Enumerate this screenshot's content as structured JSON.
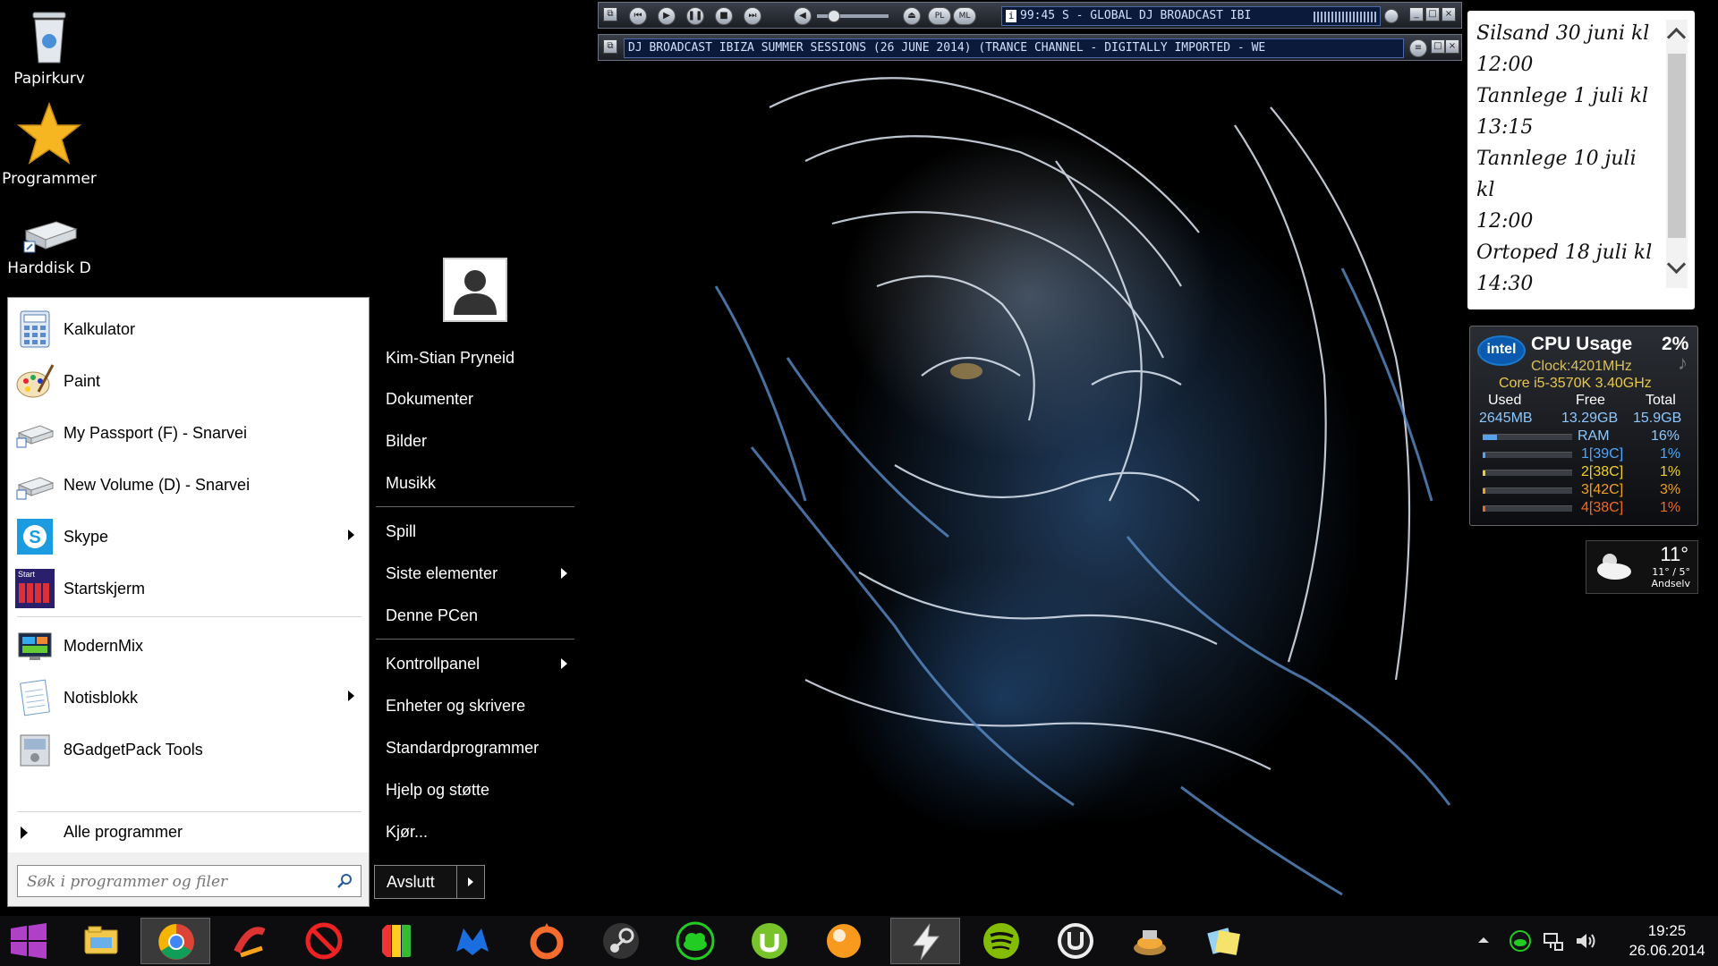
{
  "desktop": {
    "icons": [
      {
        "label": "Papirkurv",
        "icon": "recycle-bin-icon"
      },
      {
        "label": "Programmer",
        "icon": "star-icon"
      },
      {
        "label": "Harddisk D",
        "icon": "hard-drive-icon"
      }
    ]
  },
  "winamp": {
    "time": "99:45",
    "title_scroll": "S - GLOBAL DJ BROADCAST IBI",
    "playlist_scroll": "DJ BROADCAST IBIZA SUMMER SESSIONS (26 JUNE 2014) (TRANCE CHANNEL - DIGITALLY IMPORTED - WE",
    "buttons": [
      "PL",
      "ML"
    ]
  },
  "calendar_note": {
    "lines": [
      "Silsand 30 juni kl",
      "12:00",
      "Tannlege 1 juli kl",
      "13:15",
      "Tannlege 10 juli kl",
      "12:00",
      "Ortoped 18 juli kl",
      "14:30"
    ]
  },
  "cpu_gadget": {
    "brand": "intel",
    "title": "CPU Usage",
    "usage": "2%",
    "clock": "Clock:4201MHz",
    "model": "Core i5-3570K 3.40GHz",
    "headers": [
      "Used",
      "Free",
      "Total"
    ],
    "values": [
      "2645MB",
      "13.29GB",
      "15.9GB"
    ],
    "ram_label": "RAM",
    "ram_pct": "16%",
    "ram_fraction": 0.16,
    "cores": [
      {
        "label": "1[39C]",
        "pct": "1%",
        "fraction": 0.01,
        "color": "#4aa8ff"
      },
      {
        "label": "2[38C]",
        "pct": "1%",
        "fraction": 0.01,
        "color": "#f0d020"
      },
      {
        "label": "3[42C]",
        "pct": "3%",
        "fraction": 0.03,
        "color": "#f0a020"
      },
      {
        "label": "4[38C]",
        "pct": "1%",
        "fraction": 0.01,
        "color": "#f06a20"
      }
    ]
  },
  "weather": {
    "temp": "11°",
    "range": "11° / 5°",
    "location": "Andselv"
  },
  "start_menu": {
    "programs": [
      {
        "label": "Kalkulator",
        "icon": "calculator-icon",
        "submenu": false
      },
      {
        "label": "Paint",
        "icon": "paint-icon",
        "submenu": false
      },
      {
        "label": "My Passport (F) - Snarvei",
        "icon": "drive-shortcut-icon",
        "submenu": false
      },
      {
        "label": "New Volume (D) - Snarvei",
        "icon": "drive-shortcut-icon",
        "submenu": false
      },
      {
        "label": "Skype",
        "icon": "skype-icon",
        "submenu": true
      },
      {
        "label": "Startskjerm",
        "icon": "start-screen-icon",
        "submenu": false
      },
      {
        "label": "ModernMix",
        "icon": "modernmix-icon",
        "submenu": false
      },
      {
        "label": "Notisblokk",
        "icon": "notepad-icon",
        "submenu": true
      },
      {
        "label": "8GadgetPack Tools",
        "icon": "gadgetpack-icon",
        "submenu": false
      }
    ],
    "start_screen_icon_text": "Start",
    "all_programs": "Alle programmer",
    "search_placeholder": "Søk i programmer og filer",
    "user_name": "Kim-Stian Pryneid",
    "right_links": [
      {
        "label": "Dokumenter",
        "submenu": false
      },
      {
        "label": "Bilder",
        "submenu": false
      },
      {
        "label": "Musikk",
        "submenu": false
      },
      {
        "label": "Spill",
        "submenu": false
      },
      {
        "label": "Siste elementer",
        "submenu": true
      },
      {
        "label": "Denne PCen",
        "submenu": false
      },
      {
        "label": "Kontrollpanel",
        "submenu": true
      },
      {
        "label": "Enheter og skrivere",
        "submenu": false
      },
      {
        "label": "Standardprogrammer",
        "submenu": false
      },
      {
        "label": "Hjelp og støtte",
        "submenu": false
      },
      {
        "label": "Kjør...",
        "submenu": false
      }
    ],
    "shutdown": "Avslutt"
  },
  "taskbar": {
    "apps": [
      "file-explorer-icon",
      "chrome-icon",
      "ccleaner-icon",
      "blocker-icon",
      "avg-icon",
      "malwarebytes-icon",
      "origin-icon",
      "steam-icon",
      "cloud-icon",
      "utorrent-icon",
      "glary-icon",
      "winamp-icon",
      "spotify-icon",
      "ultimate-icon",
      "burner-icon",
      "sticky-notes-icon"
    ],
    "clock_time": "19:25",
    "clock_date": "26.06.2014"
  }
}
